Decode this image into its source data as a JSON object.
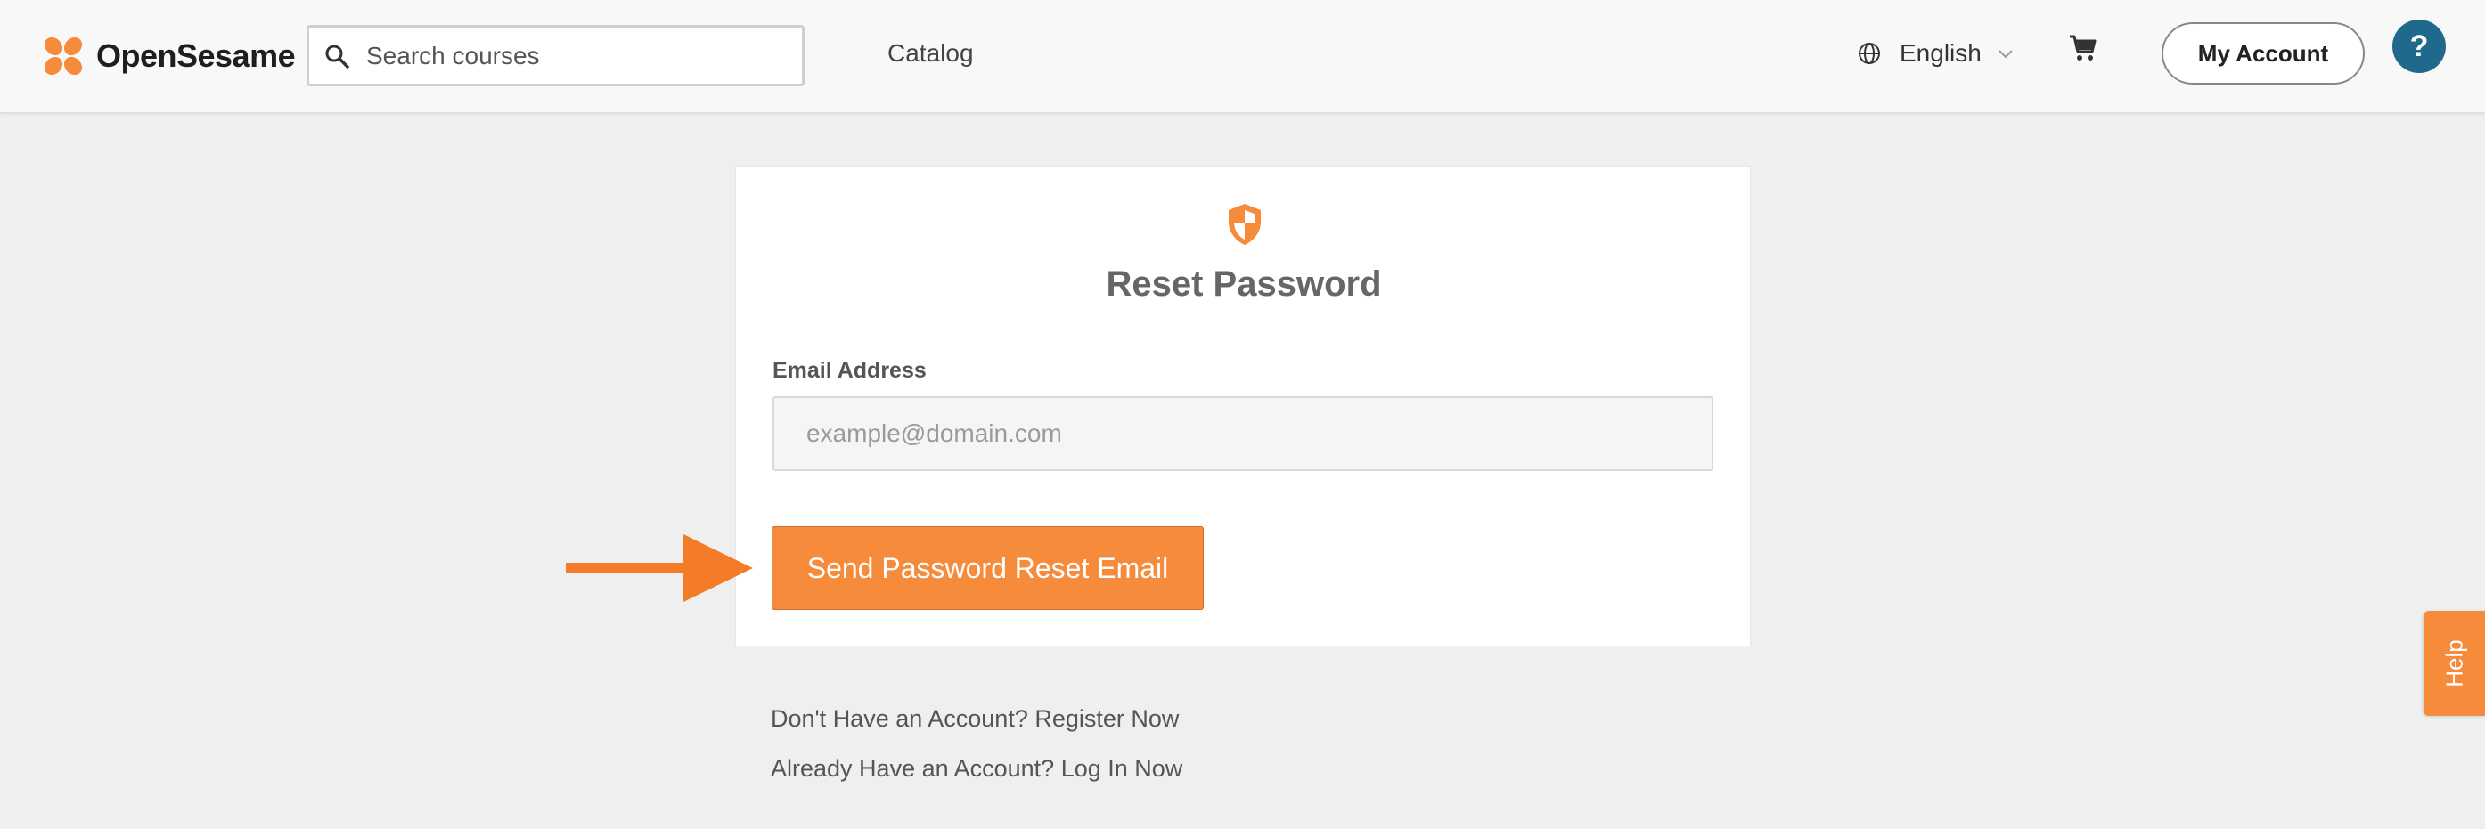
{
  "brand": {
    "name": "OpenSesame",
    "accent_color": "#f68b3b",
    "logo_icon": "clover-logo-icon"
  },
  "header": {
    "search_placeholder": "Search courses",
    "search_icon": "search-icon",
    "catalog_label": "Catalog",
    "language": {
      "icon": "globe-icon",
      "selected": "English",
      "chevron": "chevron-down-icon"
    },
    "cart_icon": "cart-icon",
    "account_button": "My Account",
    "help_button": "?"
  },
  "reset_card": {
    "icon": "shield-icon",
    "title": "Reset Password",
    "email_label": "Email Address",
    "email_placeholder": "example@domain.com",
    "email_value": "",
    "submit_button": "Send Password Reset Email"
  },
  "links": {
    "register": "Don't Have an Account? Register Now",
    "login": "Already Have an Account? Log In Now"
  },
  "help_tab": {
    "label": "Help"
  }
}
